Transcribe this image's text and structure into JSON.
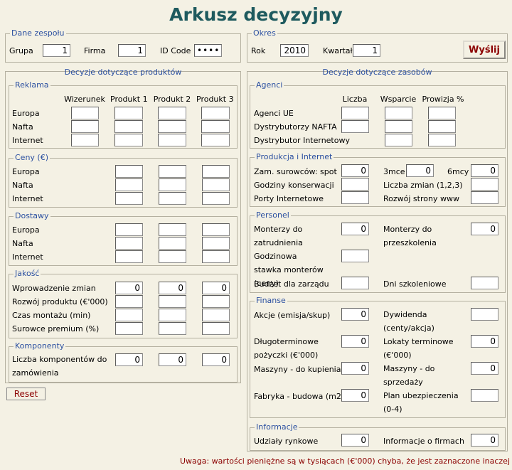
{
  "title": "Arkusz decyzyjny",
  "team": {
    "legend": "Dane zespołu",
    "group_label": "Grupa",
    "group_value": "1",
    "company_label": "Firma",
    "company_value": "1",
    "id_label": "ID Code",
    "id_value": "••••"
  },
  "period": {
    "legend": "Okres",
    "year_label": "Rok",
    "year_value": "2010",
    "quarter_label": "Kwartał",
    "quarter_value": "1",
    "send_label": "Wyślij"
  },
  "product": {
    "heading": "Decyzje dotyczące produktów",
    "ads": {
      "legend": "Reklama",
      "cols": [
        "Wizerunek",
        "Produkt 1",
        "Produkt 2",
        "Produkt 3"
      ],
      "rows": [
        "Europa",
        "Nafta",
        "Internet"
      ]
    },
    "prices": {
      "legend": "Ceny (€)",
      "rows": [
        "Europa",
        "Nafta",
        "Internet"
      ]
    },
    "delivery": {
      "legend": "Dostawy",
      "rows": [
        "Europa",
        "Nafta",
        "Internet"
      ]
    },
    "quality": {
      "legend": "Jakość",
      "rows": [
        "Wprowadzenie zmian",
        "Rozwój produktu (€'000)",
        "Czas montażu (min)",
        "Surowce premium (%)"
      ],
      "change_values": [
        "0",
        "0",
        "0"
      ]
    },
    "components": {
      "legend": "Komponenty",
      "label": "Liczba komponentów do zamówienia",
      "values": [
        "0",
        "0",
        "0"
      ]
    },
    "reset_label": "Reset"
  },
  "resources": {
    "heading": "Decyzje dotyczące zasobów",
    "agents": {
      "legend": "Agenci",
      "cols": [
        "Liczba",
        "Wsparcie",
        "Prowizja %"
      ],
      "rows": [
        "Agenci UE",
        "Dystrybutorzy NAFTA",
        "Dystrybutor Internetowy"
      ]
    },
    "production": {
      "legend": "Produkcja i Internet",
      "raw_label": "Zam. surowców:",
      "spot_label": "spot",
      "spot_value": "0",
      "m3_label": "3mce",
      "m3_value": "0",
      "m6_label": "6mcy",
      "m6_value": "0",
      "overtime_label": "Godziny konserwacji",
      "shifts_label": "Liczba zmian (1,2,3)",
      "ports_label": "Porty Internetowe",
      "web_label": "Rozwój strony www"
    },
    "personnel": {
      "legend": "Personel",
      "hire_label": "Monterzy do zatrudnienia",
      "hire_value": "0",
      "train_label": "Monterzy do przeszkolenia",
      "train_value": "0",
      "wage_label": "Godzinowa stawka monterów (ceny)",
      "budget_label": "Budżet dla zarządu",
      "days_label": "Dni szkoleniowe"
    },
    "finance": {
      "legend": "Finanse",
      "shares_label": "Akcje (emisja/skup)",
      "shares_value": "0",
      "dividend_label": "Dywidenda (centy/akcja)",
      "loan_label": "Długoterminowe pożyczki (€'000)",
      "loan_value": "0",
      "deposit_label": "Lokaty terminowe (€'000)",
      "deposit_value": "0",
      "buy_label": "Maszyny - do kupienia",
      "buy_value": "0",
      "sell_label": "Maszyny - do sprzedaży",
      "sell_value": "0",
      "factory_label": "Fabryka - budowa (m2)",
      "factory_value": "0",
      "insurance_label": "Plan ubezpieczenia (0-4)"
    },
    "info": {
      "legend": "Informacje",
      "market_label": "Udziały rynkowe",
      "market_value": "0",
      "firms_label": "Informacje o firmach",
      "firms_value": "0"
    }
  },
  "note": "Uwaga: wartości pieniężne są w tysiącach (€'000) chyba, że jest zaznaczone inaczej"
}
